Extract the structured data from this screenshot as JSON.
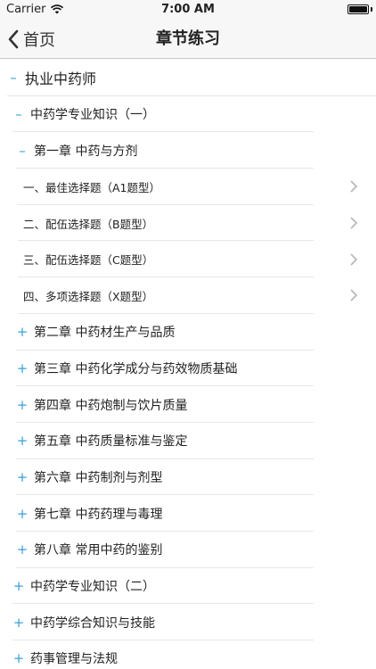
{
  "status_bar": {
    "carrier": "Carrier",
    "time": "7:00 AM"
  },
  "nav": {
    "back_label": "首页",
    "title": "章节练习"
  },
  "tree": [
    {
      "level": 0,
      "toggle": "–",
      "label": "执业中药师",
      "chevron": false
    },
    {
      "level": 1,
      "toggle": "–",
      "label": "中药学专业知识（一）",
      "chevron": false
    },
    {
      "level": 2,
      "toggle": "–",
      "label": "第一章 中药与方剂",
      "chevron": false
    },
    {
      "level": 3,
      "toggle": "",
      "label": "一、最佳选择题（A1题型）",
      "chevron": true
    },
    {
      "level": 3,
      "toggle": "",
      "label": "二、配伍选择题（B题型）",
      "chevron": true
    },
    {
      "level": 3,
      "toggle": "",
      "label": "三、配伍选择题（C题型）",
      "chevron": true
    },
    {
      "level": 3,
      "toggle": "",
      "label": "四、多项选择题（X题型）",
      "chevron": true
    },
    {
      "level": 2,
      "toggle": "+",
      "label": "第二章 中药材生产与品质",
      "chevron": false
    },
    {
      "level": 2,
      "toggle": "+",
      "label": "第三章 中药化学成分与药效物质基础",
      "chevron": false
    },
    {
      "level": 2,
      "toggle": "+",
      "label": "第四章 中药炮制与饮片质量",
      "chevron": false
    },
    {
      "level": 2,
      "toggle": "+",
      "label": "第五章 中药质量标准与鉴定",
      "chevron": false
    },
    {
      "level": 2,
      "toggle": "+",
      "label": "第六章 中药制剂与剂型",
      "chevron": false
    },
    {
      "level": 2,
      "toggle": "+",
      "label": "第七章 中药药理与毒理",
      "chevron": false
    },
    {
      "level": 2,
      "toggle": "+",
      "label": "第八章 常用中药的鉴别",
      "chevron": false
    },
    {
      "level": 1,
      "toggle": "+",
      "label": "中药学专业知识（二）",
      "chevron": false
    },
    {
      "level": 1,
      "toggle": "+",
      "label": "中药学综合知识与技能",
      "chevron": false
    },
    {
      "level": 1,
      "toggle": "+",
      "label": "药事管理与法规",
      "chevron": false
    }
  ],
  "colors": {
    "toggle": "#3aa0d8",
    "separator": "#e6e6e6",
    "nav_background": "#f7f7f7"
  }
}
